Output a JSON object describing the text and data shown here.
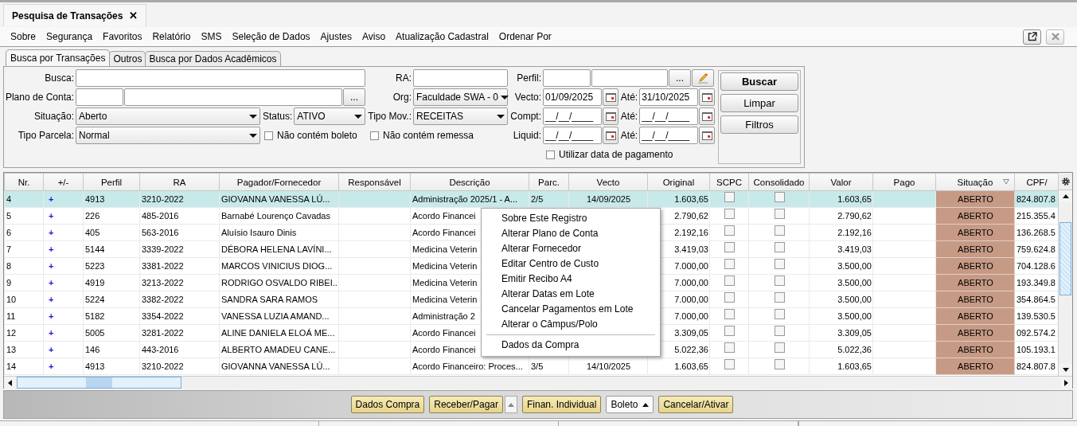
{
  "document_tab": {
    "title": "Pesquisa de Transações",
    "close": "✕"
  },
  "menu_bar": [
    "Sobre",
    "Segurança",
    "Favoritos",
    "Relatório",
    "SMS",
    "Seleção de Dados",
    "Ajustes",
    "Aviso",
    "Atualização Cadastral",
    "Ordenar Por"
  ],
  "window_buttons": [
    {
      "kind": "popout",
      "disabled": false
    },
    {
      "kind": "close",
      "disabled": true
    }
  ],
  "search_tabs": [
    {
      "label": "Busca por Transações",
      "selected": true
    },
    {
      "label": "Outros",
      "selected": false
    },
    {
      "label": "Busca por Dados Acadêmicos",
      "selected": false
    }
  ],
  "search_panel": {
    "busca": {
      "label": "Busca:"
    },
    "ra": {
      "label": "RA:"
    },
    "perfil": {
      "label": "Perfil:",
      "browse": "..."
    },
    "plano_de_conta": {
      "label": "Plano de Conta:",
      "browse": "..."
    },
    "org": {
      "label": "Org:",
      "value": "Faculdade SWA - 0"
    },
    "situacao": {
      "label": "Situação:",
      "value": "Aberto"
    },
    "status": {
      "label": "Status:",
      "value": "ATIVO"
    },
    "tipo_mov": {
      "label": "Tipo Mov.:",
      "value": "RECEITAS"
    },
    "tipo_parcela": {
      "label": "Tipo Parcela:",
      "value": "Normal"
    },
    "nao_contem_boleto": {
      "label": "Não contém boleto",
      "checked": false
    },
    "nao_contem_remessa": {
      "label": "Não contém remessa",
      "checked": false
    },
    "date_ranges": [
      {
        "label": "Vecto:",
        "from": "01/09/2025",
        "to_label": "Até:",
        "to": "31/10/2025"
      },
      {
        "label": "Compt:",
        "from": "__/__/____",
        "to_label": "Até:",
        "to": "__/__/____"
      },
      {
        "label": "Liquid:",
        "from": "__/__/____",
        "to_label": "Até:",
        "to": "__/__/____"
      }
    ],
    "utilizar_data_pagamento": {
      "label": "Utilizar data de pagamento",
      "checked": false
    },
    "buttons": [
      {
        "label": "Buscar",
        "primary": true
      },
      {
        "label": "Limpar",
        "primary": false
      },
      {
        "label": "Filtros",
        "primary": false
      }
    ]
  },
  "table": {
    "columns": [
      {
        "label": "Nr.",
        "kind": "text"
      },
      {
        "label": "+/-",
        "kind": "plus"
      },
      {
        "label": "Perfil",
        "kind": "text"
      },
      {
        "label": "RA",
        "kind": "text"
      },
      {
        "label": "Pagador/Fornecedor",
        "kind": "text"
      },
      {
        "label": "Responsável",
        "kind": "text"
      },
      {
        "label": "Descrição",
        "kind": "text"
      },
      {
        "label": "Parc.",
        "kind": "text"
      },
      {
        "label": "Vecto",
        "kind": "date"
      },
      {
        "label": "Original",
        "kind": "amount"
      },
      {
        "label": "SCPC",
        "kind": "check"
      },
      {
        "label": "Consolidado",
        "kind": "check"
      },
      {
        "label": "Valor",
        "kind": "amount"
      },
      {
        "label": "Pago",
        "kind": "amount"
      },
      {
        "label": "Situação",
        "kind": "status",
        "filter": true
      },
      {
        "label": "CPF/",
        "kind": "text"
      }
    ],
    "rows": [
      {
        "selected": true,
        "cells": [
          "4",
          "+",
          "4913",
          "3210-2022",
          "GIOVANNA VANESSA LÚ...",
          "",
          "Administração 2025/1 - A...",
          "2/5",
          "14/09/2025",
          "1.603,65",
          false,
          false,
          "1.603,65",
          "",
          "ABERTO",
          "824.807.8"
        ]
      },
      {
        "selected": false,
        "cells": [
          "5",
          "+",
          "226",
          "485-2016",
          "Barnabé Lourenço Cavadas",
          "",
          "Acordo Financei",
          "",
          "",
          "2.790,62",
          false,
          false,
          "2.790,62",
          "",
          "ABERTO",
          "215.355.4"
        ]
      },
      {
        "selected": false,
        "cells": [
          "6",
          "+",
          "405",
          "563-2016",
          "Aluísio Isauro Dinis",
          "",
          "Acordo Financei",
          "",
          "",
          "2.192,16",
          false,
          false,
          "2.192,16",
          "",
          "ABERTO",
          "136.268.5"
        ]
      },
      {
        "selected": false,
        "cells": [
          "7",
          "+",
          "5144",
          "3339-2022",
          "DÉBORA HELENA LAVÍNI...",
          "",
          "Medicina Veterin",
          "",
          "",
          "3.419,03",
          false,
          false,
          "3.419,03",
          "",
          "ABERTO",
          "759.624.8"
        ]
      },
      {
        "selected": false,
        "cells": [
          "8",
          "+",
          "5223",
          "3381-2022",
          "MARCOS VINICIUS DIOG...",
          "",
          "Medicina Veterin",
          "",
          "",
          "7.000,00",
          false,
          false,
          "3.500,00",
          "",
          "ABERTO",
          "704.128.6"
        ]
      },
      {
        "selected": false,
        "cells": [
          "9",
          "+",
          "4919",
          "3213-2022",
          "RODRIGO OSVALDO RIBEI...",
          "",
          "Medicina Veterin",
          "",
          "",
          "7.000,00",
          false,
          false,
          "3.500,00",
          "",
          "ABERTO",
          "193.349.8"
        ]
      },
      {
        "selected": false,
        "cells": [
          "10",
          "+",
          "5224",
          "3382-2022",
          "SANDRA SARA RAMOS",
          "",
          "Medicina Veterin",
          "",
          "",
          "7.000,00",
          false,
          false,
          "3.500,00",
          "",
          "ABERTO",
          "354.864.5"
        ]
      },
      {
        "selected": false,
        "cells": [
          "11",
          "+",
          "5182",
          "3354-2022",
          "VANESSA LUZIA AMAND...",
          "",
          "Administração 2",
          "",
          "",
          "7.000,00",
          false,
          false,
          "3.500,00",
          "",
          "ABERTO",
          "139.530.5"
        ]
      },
      {
        "selected": false,
        "cells": [
          "12",
          "+",
          "5005",
          "3281-2022",
          "ALINE DANIELA ELOÁ ME...",
          "",
          "Acordo Financei",
          "",
          "",
          "3.309,05",
          false,
          false,
          "3.309,05",
          "",
          "ABERTO",
          "092.574.2"
        ]
      },
      {
        "selected": false,
        "cells": [
          "13",
          "+",
          "146",
          "443-2016",
          "ALBERTO AMADEU CANE...",
          "",
          "Acordo Financei",
          "",
          "",
          "5.022,36",
          false,
          false,
          "5.022,36",
          "",
          "ABERTO",
          "105.193.1"
        ]
      },
      {
        "selected": false,
        "cells": [
          "14",
          "+",
          "4913",
          "3210-2022",
          "GIOVANNA VANESSA LÚ...",
          "",
          "Acordo Financeiro: Proces...",
          "3/5",
          "14/10/2025",
          "1.603,65",
          false,
          false,
          "1.603,65",
          "",
          "ABERTO",
          "824.807.8"
        ]
      }
    ]
  },
  "context_menu": [
    {
      "label": "Sobre Este Registro",
      "separator_before": false
    },
    {
      "label": "Alterar Plano de Conta",
      "separator_before": false
    },
    {
      "label": "Alterar Fornecedor",
      "separator_before": false
    },
    {
      "label": "Editar Centro de Custo",
      "separator_before": false
    },
    {
      "label": "Emitir Recibo A4",
      "separator_before": false
    },
    {
      "label": "Alterar Datas em Lote",
      "separator_before": false
    },
    {
      "label": "Cancelar Pagamentos em Lote",
      "separator_before": false
    },
    {
      "label": "Alterar o Câmpus/Polo",
      "separator_before": false
    },
    {
      "label": "Dados da Compra",
      "separator_before": true
    }
  ],
  "bottom_toolbar": [
    {
      "label": "Dados Compra",
      "kind": "button"
    },
    {
      "label": "Receber/Pagar",
      "kind": "split"
    },
    {
      "label": "Finan. Individual",
      "kind": "button"
    },
    {
      "label": "Boleto",
      "kind": "dropdown"
    },
    {
      "label": "Cancelar/Ativar",
      "kind": "button"
    }
  ]
}
